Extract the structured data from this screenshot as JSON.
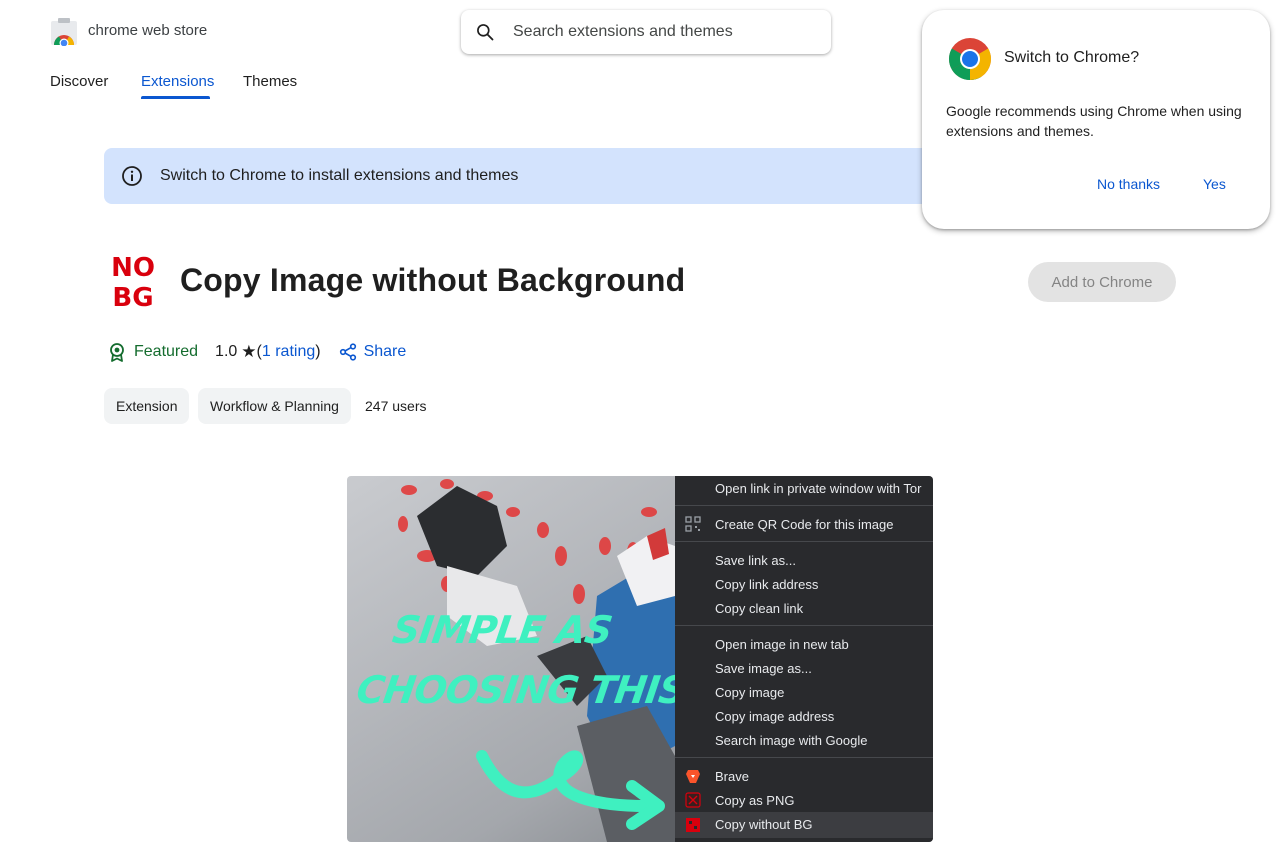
{
  "header": {
    "brand": "chrome web store",
    "search_placeholder": "Search extensions and themes"
  },
  "nav": {
    "tabs": [
      {
        "label": "Discover",
        "active": false
      },
      {
        "label": "Extensions",
        "active": true
      },
      {
        "label": "Themes",
        "active": false
      }
    ]
  },
  "banner": {
    "text": "Switch to Chrome to install extensions and themes"
  },
  "popup": {
    "title": "Switch to Chrome?",
    "body": "Google recommends using Chrome when using extensions and themes.",
    "no_thanks": "No thanks",
    "yes": "Yes"
  },
  "extension": {
    "logo_text": [
      "NO",
      "BG"
    ],
    "title": "Copy Image without Background",
    "add_button": "Add to Chrome",
    "featured": "Featured",
    "rating_value": "1.0",
    "rating_star": "★",
    "rating_open": "(",
    "rating_link": "1 rating",
    "rating_close": ")",
    "share": "Share",
    "chips": [
      "Extension",
      "Workflow & Planning"
    ],
    "users": "247 users"
  },
  "screenshot": {
    "slogan_line1": "SIMPLE AS",
    "slogan_line2": "CHOOSING THIS!",
    "menu_items": [
      "Open link in private window with Tor",
      "Create QR Code for this image",
      "Save link as...",
      "Copy link address",
      "Copy clean link",
      "Open image in new tab",
      "Save image as...",
      "Copy image",
      "Copy image address",
      "Search image with Google",
      "Brave",
      "Copy as PNG",
      "Copy without BG"
    ]
  },
  "colors": {
    "accent": "#0b57d0",
    "featured_green": "#146c2e",
    "banner_bg": "#d3e3fd",
    "logo_red": "#d9000d",
    "slogan": "#3ff0c0",
    "menu_bg": "#292a2d"
  },
  "icons": {
    "logo": "chrome-web-store-icon",
    "search": "search-icon",
    "info": "info-icon",
    "chrome": "chrome-logo-icon",
    "featured": "featured-badge-icon",
    "share": "share-icon",
    "qr": "qr-code-icon",
    "brave": "brave-icon",
    "png": "copy-png-icon",
    "nobg": "nobg-icon"
  }
}
